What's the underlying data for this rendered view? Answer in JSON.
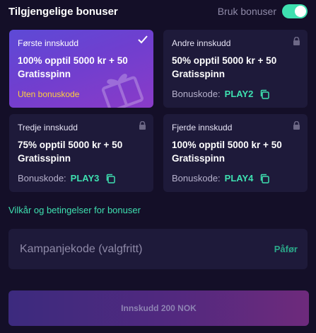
{
  "header": {
    "title": "Tilgjengelige bonuser",
    "toggle_label": "Bruk bonuser",
    "toggle_on": true
  },
  "bonuses": [
    {
      "name": "Første innskudd",
      "offer": "100% opptil 5000 kr + 50 Gratisspinn",
      "no_code_text": "Uten bonuskode",
      "selected": true,
      "icon": "check-icon"
    },
    {
      "name": "Andre innskudd",
      "offer": "50% opptil 5000 kr + 50 Gratisspinn",
      "code_label": "Bonuskode:",
      "code": "PLAY2",
      "locked": true,
      "icon": "lock-icon"
    },
    {
      "name": "Tredje innskudd",
      "offer": "75% opptil 5000 kr + 50 Gratisspinn",
      "code_label": "Bonuskode:",
      "code": "PLAY3",
      "locked": true,
      "icon": "lock-icon"
    },
    {
      "name": "Fjerde innskudd",
      "offer": "100% opptil 5000 kr + 50 Gratisspinn",
      "code_label": "Bonuskode:",
      "code": "PLAY4",
      "locked": true,
      "icon": "lock-icon"
    }
  ],
  "terms_link": "Vilkår og betingelser for bonuser",
  "promo": {
    "placeholder": "Kampanjekode (valgfritt)",
    "value": "",
    "apply_label": "Påfør"
  },
  "submit_label": "Innskudd 200 NOK",
  "colors": {
    "accent": "#3ee0b0",
    "background": "#140f28",
    "card": "#1e1a3a",
    "selected_card": "#6f3fcf",
    "no_code": "#ffcf3d"
  }
}
